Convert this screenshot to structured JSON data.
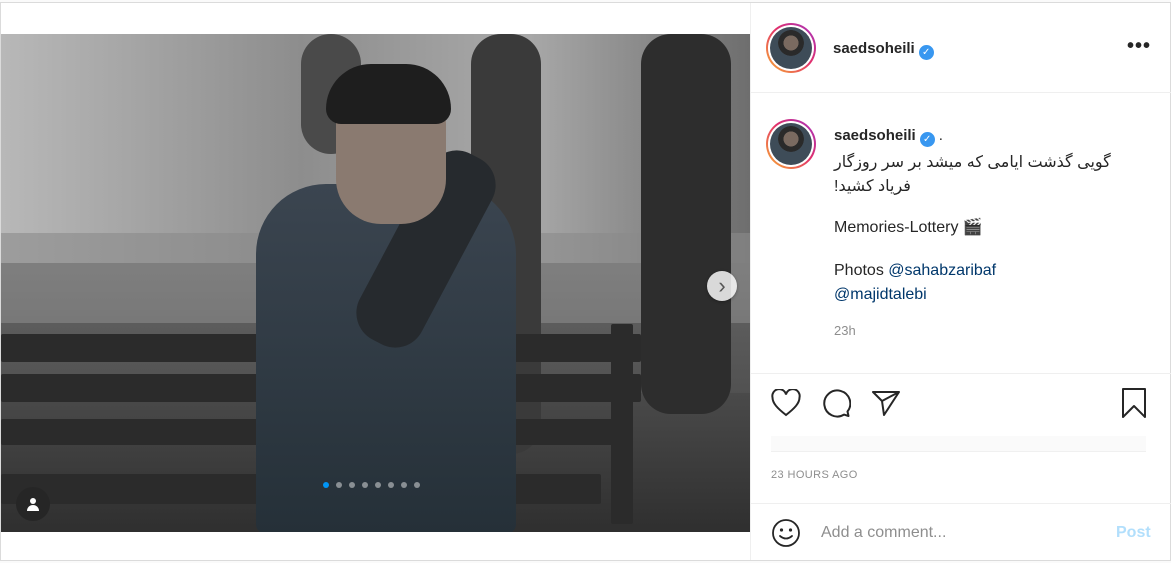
{
  "header": {
    "username": "saedsoheili",
    "verified_icon": "verified-badge-icon",
    "more_icon": "more-options-icon"
  },
  "carousel": {
    "slide_count": 8,
    "active_slide": 1,
    "next_icon": "chevron-right-icon",
    "tag_icon": "user-tag-icon"
  },
  "caption": {
    "username": "saedsoheili",
    "separator": ".",
    "text_line_1": "گویی گذشت ایامی که میشد بر سر روزگار",
    "text_line_2": "فریاد کشید!",
    "title_line": "Memories-Lottery 🎬",
    "photos_label": "Photos",
    "mention_1": "@sahabzaribaf",
    "mention_2": "@majidtalebi",
    "time": "23h"
  },
  "actions": {
    "like_icon": "heart-icon",
    "comment_icon": "comment-icon",
    "share_icon": "share-icon",
    "save_icon": "bookmark-icon"
  },
  "timestamp": "23 HOURS AGO",
  "comment": {
    "emoji_icon": "emoji-icon",
    "placeholder": "Add a comment...",
    "post_label": "Post"
  },
  "colors": {
    "accent": "#0095f6",
    "verified": "#3897f0",
    "post_disabled": "#b2dffc",
    "muted": "#8e8e8e",
    "link": "#00376b"
  }
}
